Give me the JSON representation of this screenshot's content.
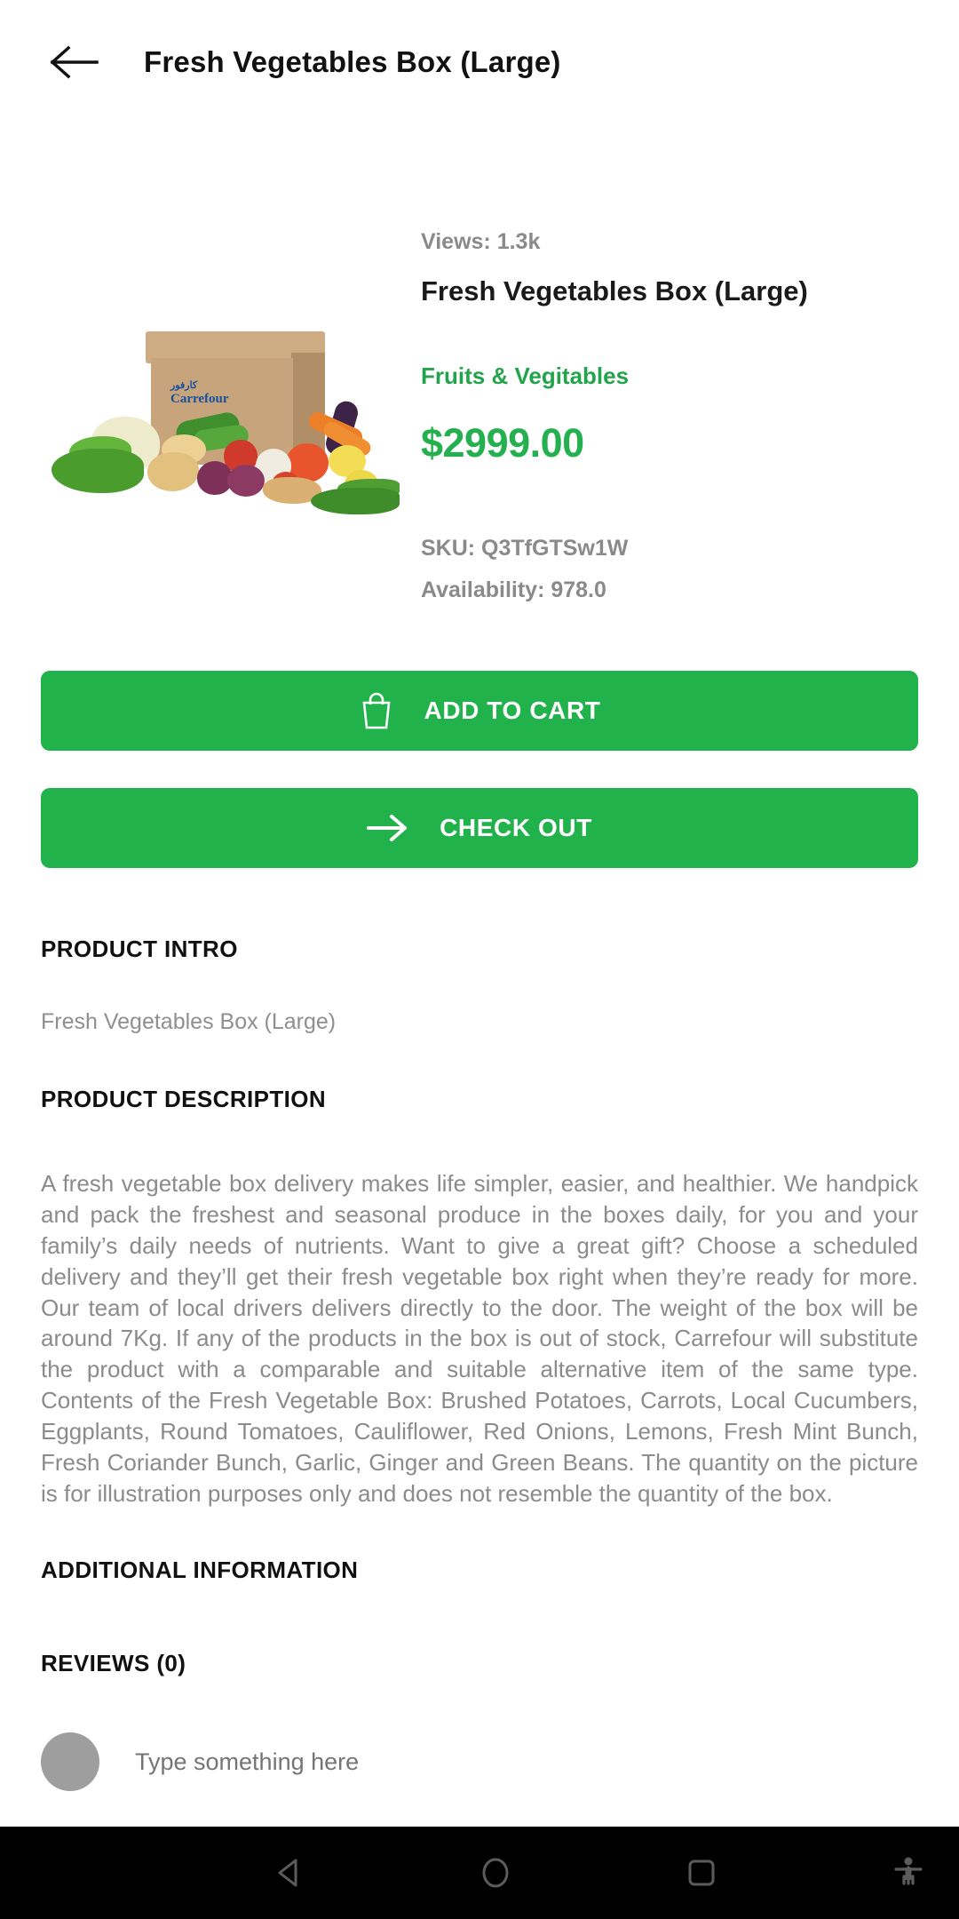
{
  "appbar": {
    "back_icon": "arrow-left-icon",
    "title": "Fresh Vegetables Box (Large)"
  },
  "product": {
    "views": "Views: 1.3k",
    "title": "Fresh Vegetables Box (Large)",
    "category": "Fruits & Vegitables",
    "price": "$2999.00",
    "sku": "SKU: Q3TfGTSw1W",
    "availability": "Availability: 978.0",
    "image_alt": "Carrefour fresh vegetables box with assorted produce"
  },
  "actions": {
    "add_to_cart": "ADD TO CART",
    "add_to_cart_icon": "shopping-bag-icon",
    "check_out": "CHECK OUT",
    "check_out_icon": "arrow-right-icon"
  },
  "sections": {
    "intro_heading": "PRODUCT INTRO",
    "intro_text": "Fresh Vegetables Box (Large)",
    "description_heading": "PRODUCT DESCRIPTION",
    "description_text": "A fresh vegetable box delivery makes life simpler, easier, and healthier. We handpick and pack the freshest and seasonal produce in the boxes daily, for you and your family’s daily needs of nutrients. Want to give a great gift? Choose a scheduled delivery and they’ll get their fresh vegetable box right when they’re ready for more. Our team of local drivers delivers directly to the door. The weight of the box will be around 7Kg. If any of the products in the box is out of stock, Carrefour will substitute the product with a comparable and suitable alternative item of the same type. Contents of the Fresh Vegetable Box: Brushed Potatoes, Carrots, Local Cucumbers, Eggplants, Round Tomatoes, Cauliflower, Red Onions, Lemons, Fresh Mint Bunch, Fresh Coriander Bunch, Garlic, Ginger and Green Beans. The quantity on the picture is for illustration purposes only and does not resemble the quantity of the box.",
    "additional_heading": "ADDITIONAL INFORMATION",
    "reviews_heading": "REVIEWS (0)"
  },
  "comment": {
    "placeholder": "Type something here",
    "value": "",
    "avatar_icon": "user-avatar"
  },
  "navbar": {
    "back_icon": "triangle-back-icon",
    "home_icon": "circle-home-icon",
    "recent_icon": "square-recents-icon",
    "accessibility_icon": "accessibility-icon"
  },
  "colors": {
    "accent_green": "#22b24c",
    "price_green": "#25b04f",
    "category_green": "#22a44b",
    "muted_gray": "#8b8b8b",
    "navbar_black": "#000000"
  }
}
